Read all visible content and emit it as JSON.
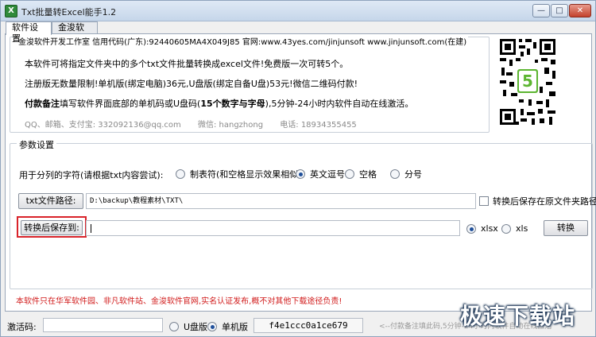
{
  "window": {
    "title": "Txt批量转Excel能手1.2",
    "buttons": {
      "minimize": "—",
      "maximize": "□",
      "close": "✕"
    }
  },
  "tabs": [
    {
      "label": "软件设置",
      "active": true
    },
    {
      "label": "金浚软件",
      "active": false
    }
  ],
  "info": {
    "legend": "金浚软件开发工作室 信用代码(广东):92440605MA4X049J85 官网:www.43yes.com/jinjunsoft  www.jinjunsoft.com(在建)",
    "line1": "本软件可将指定文件夹中的多个txt文件批量转换成excel文件!免费版一次可转5个。",
    "line2": "注册版无数量限制!单机版(绑定电脑)36元,U盘版(绑定自备U盘)53元!微信二维码付款!",
    "line3_bold": "付款备注",
    "line3_rest": "填写软件界面底部的单机码或U盘码(",
    "line3_bold2": "15个数字与字母",
    "line3_tail": "),5分钟-24小时内软件自动在线激活。",
    "contacts": [
      "QQ、邮箱、支付宝: 332092136@qq.com",
      "微信: hangzhong",
      "电话: 18934355455"
    ],
    "qr_badge": "5"
  },
  "params": {
    "legend": "参数设置",
    "sep_label": "用于分列的字符(请根据txt内容尝试):",
    "separators": [
      {
        "label": "制表符(和空格显示效果相似)",
        "selected": false
      },
      {
        "label": "英文逗号",
        "selected": true
      },
      {
        "label": "空格",
        "selected": false
      },
      {
        "label": "分号",
        "selected": false
      }
    ],
    "txt_path_button": "txt文件路径:",
    "txt_path_value": "D:\\backup\\教程素材\\TXT\\",
    "save_same_folder": "转换后保存在原文件夹路径",
    "save_to_button": "转换后保存到:",
    "save_to_value": "",
    "formats": [
      {
        "label": "xlsx",
        "selected": true
      },
      {
        "label": "xls",
        "selected": false
      }
    ],
    "convert_button": "转换"
  },
  "warning": "本软件只在华军软件园、非凡软件站、金浚软件官网,实名认证发布,概不对其他下载途径负责!",
  "bottom": {
    "activation_label": "激活码:",
    "activation_value": "",
    "modes": [
      {
        "label": "U盘版",
        "selected": false
      },
      {
        "label": "单机版",
        "selected": true
      }
    ],
    "machine_code": "f4e1ccc0a1ce679",
    "hint": "<--付款备注填此码,5分钟-24小时内软件自动在线激活"
  },
  "watermark": "极速下载站",
  "colors": {
    "warning": "#d11b1b",
    "highlight_box": "#d9232a",
    "qr_badge": "#5cb531"
  }
}
